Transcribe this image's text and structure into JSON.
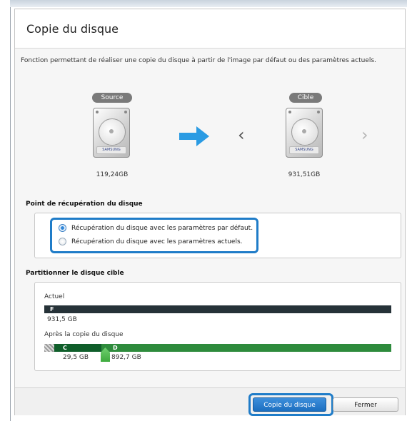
{
  "dialog": {
    "title": "Copie du disque",
    "description": "Fonction permettant de réaliser une copie du disque à partir de l'image par défaut ou des paramètres actuels."
  },
  "source": {
    "label": "Source",
    "size": "119,24GB",
    "brand": "SAMSUNG"
  },
  "target": {
    "label": "Cible",
    "size": "931,51GB",
    "brand": "SAMSUNG"
  },
  "recovery": {
    "heading": "Point de récupération du disque",
    "options": [
      {
        "label": "Récupération du disque avec les paramètres par défaut.",
        "selected": true
      },
      {
        "label": "Récupération du disque avec les paramètres actuels.",
        "selected": false
      }
    ]
  },
  "partition": {
    "heading": "Partitionner le disque cible",
    "current_label": "Actuel",
    "current_letter": "F",
    "current_size": "931,5 GB",
    "after_label": "Après la copie du disque",
    "after_c_letter": "C",
    "after_d_letter": "D",
    "after_c_size": "29,5 GB",
    "after_d_size": "892,7 GB"
  },
  "buttons": {
    "copy": "Copie du disque",
    "close": "Fermer"
  },
  "colors": {
    "accent": "#1f7cc8",
    "partition_dark": "#263238",
    "partition_green": "#2e8b3c"
  }
}
